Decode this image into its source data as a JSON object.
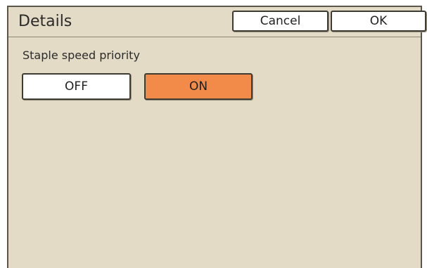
{
  "header": {
    "title": "Details",
    "cancel_label": "Cancel",
    "ok_label": "OK"
  },
  "setting": {
    "label": "Staple speed priority",
    "off_label": "OFF",
    "on_label": "ON",
    "selected": "ON"
  },
  "colors": {
    "panel_background": "#e4dbc6",
    "selected_option": "#f28a4a",
    "button_background": "#ffffff"
  }
}
